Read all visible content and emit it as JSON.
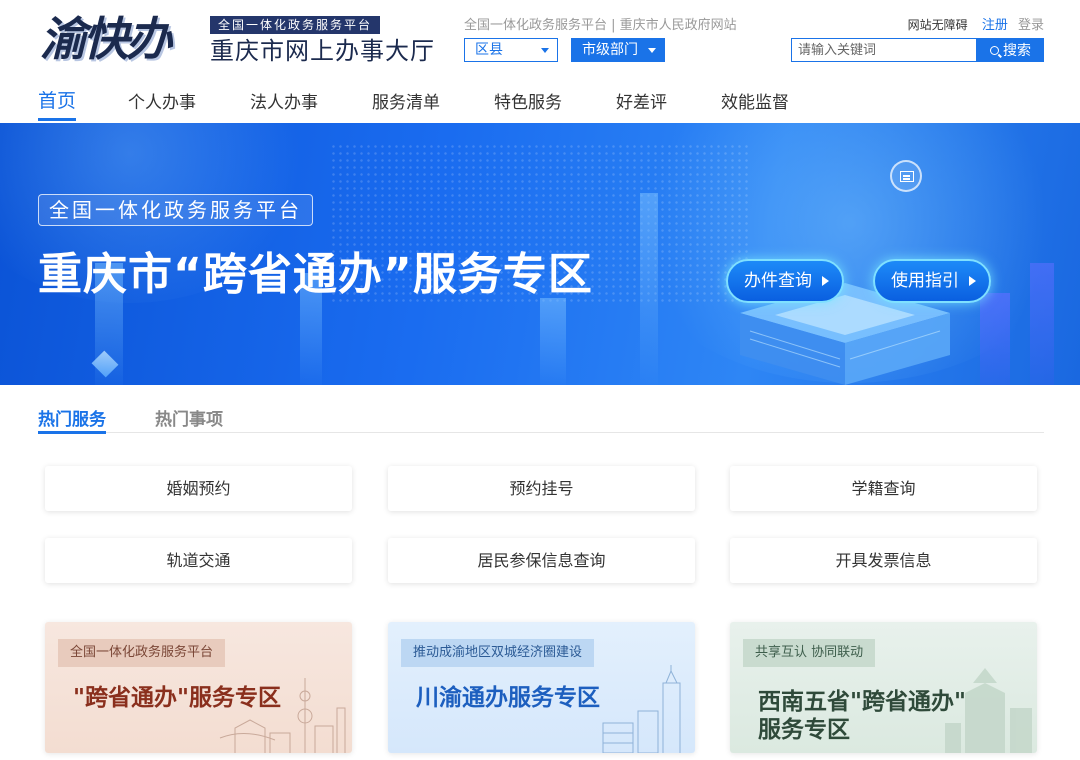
{
  "header": {
    "logo_mark": "渝快办",
    "logo_slogan": "全国一体化政务服务平台",
    "logo_title": "重庆市网上办事大厅",
    "top_links": "全国一体化政务服务平台 | 重庆市人民政府网站",
    "area_select": "区县",
    "dept_select": "市级部门",
    "accessibility": "网站无障碍",
    "register": "注册",
    "login": "登录",
    "search_placeholder": "请输入关键词",
    "search_button": "搜索"
  },
  "nav": {
    "items": [
      "首页",
      "个人办事",
      "法人办事",
      "服务清单",
      "特色服务",
      "好差评",
      "效能监督"
    ],
    "active_index": 0
  },
  "banner": {
    "tag": "全国一体化政务服务平台",
    "title": "重庆市“跨省通办”服务专区",
    "buttons": [
      "办件查询",
      "使用指引"
    ]
  },
  "tabs": {
    "items": [
      "热门服务",
      "热门事项"
    ],
    "active_index": 0
  },
  "services": [
    "婚姻预约",
    "预约挂号",
    "学籍查询",
    "轨道交通",
    "居民参保信息查询",
    "开具发票信息"
  ],
  "cards": [
    {
      "tag": "全国一体化政务服务平台",
      "title": "\"跨省通办\"服务专区"
    },
    {
      "tag": "推动成渝地区双城经济圈建设",
      "title": "川渝通办服务专区"
    },
    {
      "tag": "共享互认 协同联动",
      "title": "西南五省\"跨省通办\"",
      "title2": "服务专区"
    }
  ],
  "colors": {
    "primary": "#1a73e8",
    "banner": "#1a6cf0",
    "logo": "#1b2a4e"
  }
}
